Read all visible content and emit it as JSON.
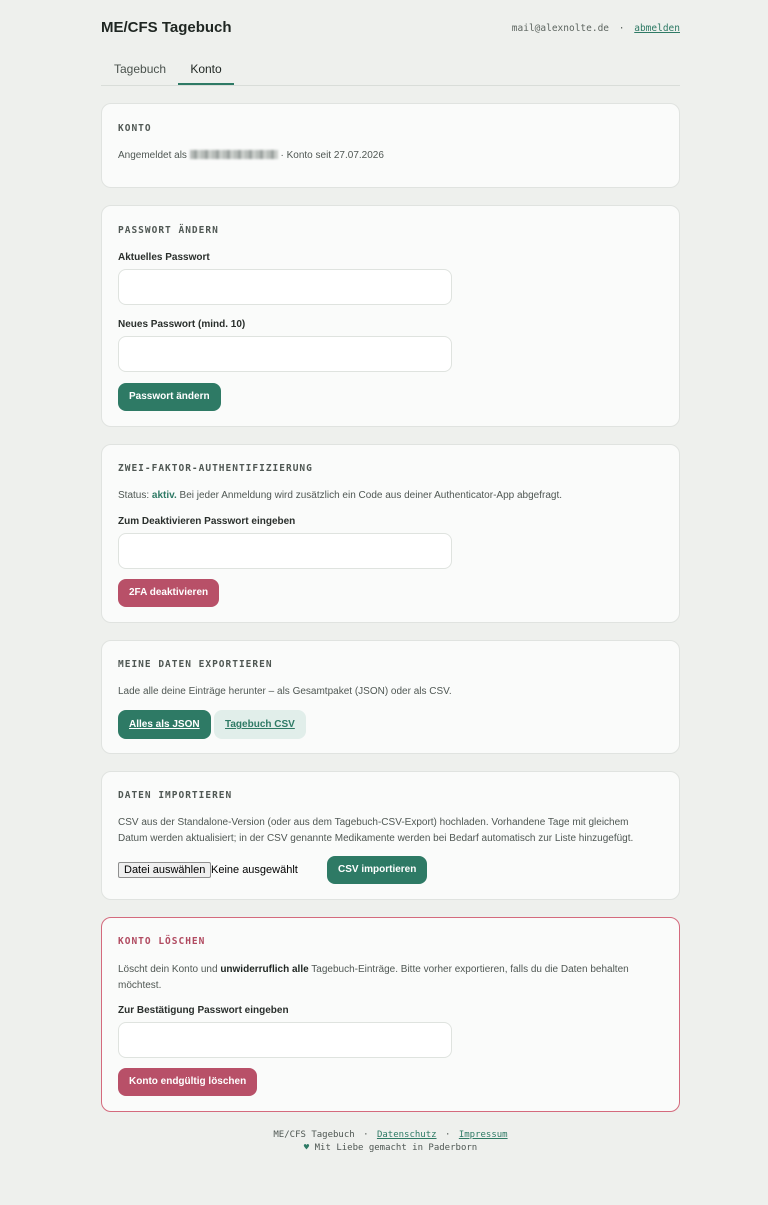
{
  "header": {
    "app_title": "ME/CFS Tagebuch",
    "email": "mail@alexnolte.de",
    "separator": "·",
    "logout": "abmelden"
  },
  "tabs": [
    {
      "label": "Tagebuch",
      "active": false
    },
    {
      "label": "Konto",
      "active": true
    }
  ],
  "account": {
    "title": "KONTO",
    "logged_in_prefix": "Angemeldet als",
    "member_since": "· Konto seit 27.07.2026"
  },
  "password": {
    "title": "PASSWORT ÄNDERN",
    "current_label": "Aktuelles Passwort",
    "new_label": "Neues Passwort (mind. 10)",
    "button": "Passwort ändern"
  },
  "twofa": {
    "title": "ZWEI-FAKTOR-AUTHENTIFIZIERUNG",
    "status_prefix": "Status:",
    "status_value": "aktiv.",
    "status_text": "Bei jeder Anmeldung wird zusätzlich ein Code aus deiner Authenticator-App abgefragt.",
    "label": "Zum Deaktivieren Passwort eingeben",
    "button": "2FA deaktivieren"
  },
  "export": {
    "title": "MEINE DATEN EXPORTIEREN",
    "text": "Lade alle deine Einträge herunter – als Gesamtpaket (JSON) oder als CSV.",
    "json_button": "Alles als JSON",
    "csv_button": "Tagebuch CSV"
  },
  "import": {
    "title": "DATEN IMPORTIEREN",
    "text_line1": "CSV aus der Standalone-Version (oder aus dem Tagebuch-CSV-Export) hochladen. Vorhandene Tage mit gleichem",
    "text_line2": "Datum werden aktualisiert; in der CSV genannte Medikamente werden bei Bedarf automatisch zur Liste hinzugefügt.",
    "file_button": "Datei auswählen",
    "file_status": "Keine ausgewählt",
    "button": "CSV importieren"
  },
  "delete": {
    "title": "KONTO LÖSCHEN",
    "text_prefix": "Löscht dein Konto und",
    "text_bold": "unwiderruflich alle",
    "text_suffix": "Tagebuch-Einträge. Bitte vorher exportieren, falls du die Daten behalten",
    "text_line2": "möchtest.",
    "label": "Zur Bestätigung Passwort eingeben",
    "button": "Konto endgültig löschen"
  },
  "footer": {
    "app_name": "ME/CFS Tagebuch",
    "separator": "·",
    "privacy": "Datenschutz",
    "imprint": "Impressum",
    "tagline": "Mit Liebe gemacht in Paderborn"
  },
  "colors": {
    "accent": "#2e7a65",
    "danger": "#b85068",
    "background": "#eef0ed"
  }
}
